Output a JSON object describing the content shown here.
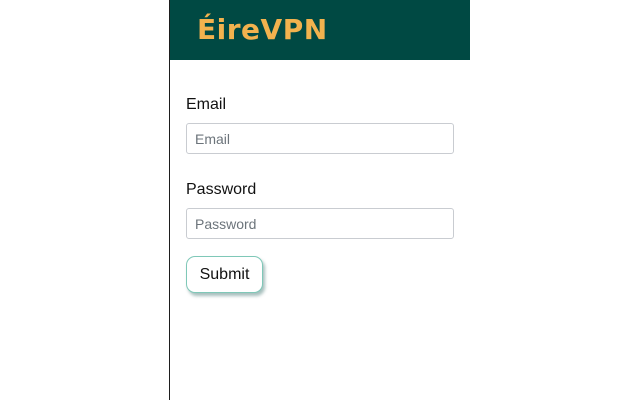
{
  "header": {
    "brand": "ÉireVPN"
  },
  "form": {
    "email": {
      "label": "Email",
      "placeholder": "Email",
      "value": ""
    },
    "password": {
      "label": "Password",
      "placeholder": "Password",
      "value": ""
    },
    "submit_label": "Submit"
  },
  "colors": {
    "header_bg": "#004943",
    "brand_text": "#f2b24e",
    "button_border": "#7fc8b8"
  }
}
